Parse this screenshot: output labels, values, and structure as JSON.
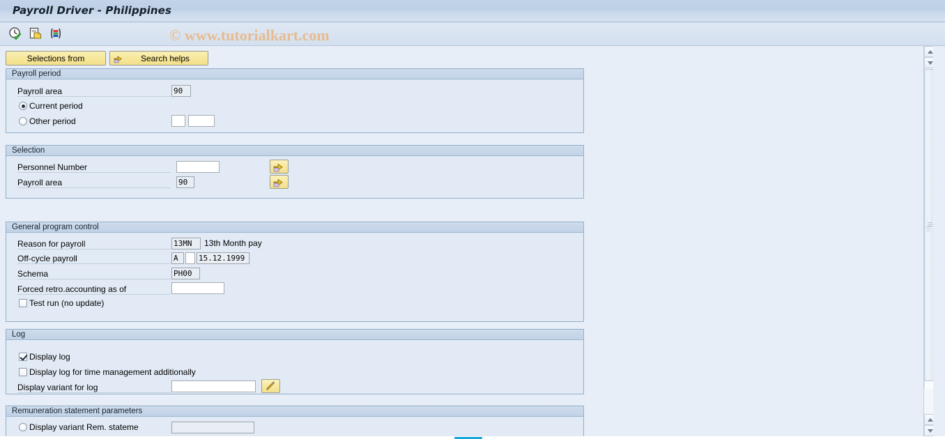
{
  "window": {
    "title": "Payroll Driver - Philippines"
  },
  "watermark": {
    "text": "© www.tutorialkart.com"
  },
  "toolbar": {
    "icons": [
      {
        "name": "execute-clock-icon",
        "title": "Execute"
      },
      {
        "name": "copy-variant-icon",
        "title": "Get variant"
      },
      {
        "name": "colored-bars-icon",
        "title": "Display list"
      }
    ]
  },
  "buttons": {
    "selections_from": "Selections from",
    "search_helps": "Search helps"
  },
  "sections": {
    "payroll_period": {
      "title": "Payroll period",
      "payroll_area_label": "Payroll area",
      "payroll_area_value": "90",
      "current_period_label": "Current period",
      "current_period_selected": true,
      "other_period_label": "Other period",
      "other_period_selected": false,
      "other_period_value_1": "",
      "other_period_value_2": ""
    },
    "selection": {
      "title": "Selection",
      "personnel_number_label": "Personnel Number",
      "personnel_number_value": "",
      "payroll_area_label": "Payroll area",
      "payroll_area_value": "90",
      "multi_select_button_1": "multi-selection-arrow-icon",
      "multi_select_button_2": "multi-selection-arrow-icon"
    },
    "general_program_control": {
      "title": "General program control",
      "reason_label": "Reason for payroll",
      "reason_value": "13MN",
      "reason_text": "13th Month pay",
      "offcycle_label": "Off-cycle payroll",
      "offcycle_value_1": "A",
      "offcycle_value_2": "",
      "offcycle_date": "15.12.1999",
      "schema_label": "Schema",
      "schema_value": "PH00",
      "forced_retro_label": "Forced retro.accounting as of",
      "forced_retro_value": "",
      "test_run_label": "Test run (no update)",
      "test_run_checked": false
    },
    "log": {
      "title": "Log",
      "display_log_label": "Display log",
      "display_log_checked": true,
      "display_log_time_label": "Display log for time management additionally",
      "display_log_time_checked": false,
      "display_variant_label": "Display variant for log",
      "display_variant_value": "",
      "edit_button": "pencil-edit-icon"
    },
    "remuneration": {
      "title": "Remuneration statement parameters",
      "display_variant_label": "Display variant Rem. stateme",
      "display_variant_selected": false,
      "display_variant_value": ""
    }
  },
  "scrollbars": {
    "outer_vertical_position": "top",
    "inner_vertical_position": "top",
    "horizontal_position": "middle"
  },
  "colors": {
    "title_bar": "#c3d4e8",
    "page_background": "#e8eef7",
    "panel_background": "#e2ebf5",
    "panel_border": "#90aecb",
    "panel_header": "#c6d6e9",
    "button_yellow": "#f7e79a",
    "watermark": "#e8b98a",
    "hscroll_accent": "#16a7d8"
  }
}
